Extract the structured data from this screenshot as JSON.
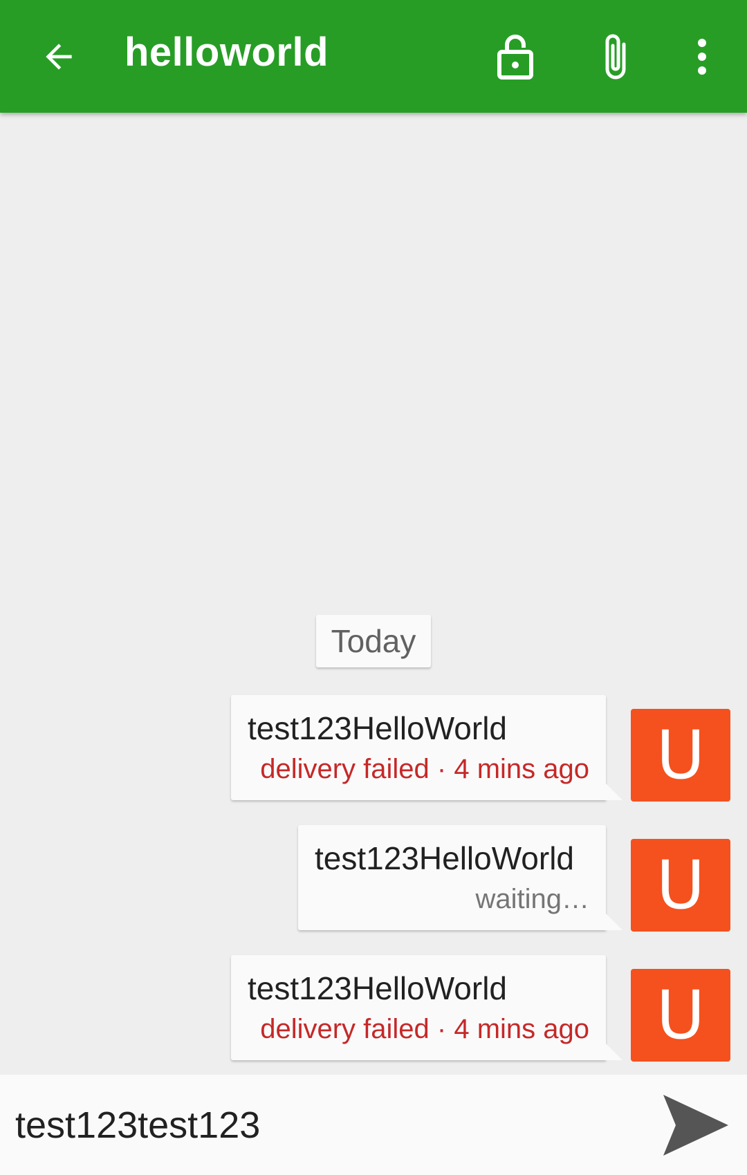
{
  "toolbar": {
    "title": "helloworld",
    "back_icon": "arrow-back-icon",
    "lock_icon": "lock-open-icon",
    "attach_icon": "paperclip-icon",
    "more_icon": "more-vert-icon",
    "color": "#279d26"
  },
  "conversation": {
    "date_divider": "Today",
    "messages": [
      {
        "text": "test123HelloWorld",
        "status": "delivery failed · 4 mins ago",
        "status_type": "failed",
        "avatar_letter": "U"
      },
      {
        "text": "test123HelloWorld",
        "status": "waiting…",
        "status_type": "waiting",
        "avatar_letter": "U"
      },
      {
        "text": "test123HelloWorld",
        "status": "delivery failed · 4 mins ago",
        "status_type": "failed",
        "avatar_letter": "U"
      }
    ],
    "avatar_color": "#f4511e",
    "failed_color": "#c62828"
  },
  "composer": {
    "value": "test123test123",
    "send_icon": "send-icon"
  }
}
